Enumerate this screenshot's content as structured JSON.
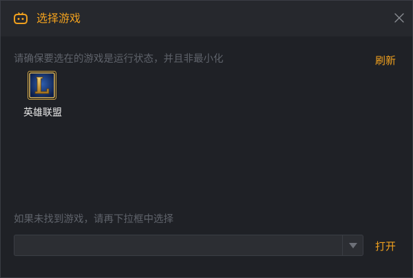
{
  "window": {
    "title": "选择游戏",
    "title_icon": "gamepad-icon",
    "close_icon": "close-icon"
  },
  "main": {
    "hint": "请确保要选在的游戏是运行状态，并且非最小化",
    "refresh_label": "刷新",
    "games": [
      {
        "label": "英雄联盟",
        "icon": "league-of-legends-logo-icon"
      }
    ],
    "secondary_hint": "如果未找到游戏，请再下拉框中选择",
    "select_value": "",
    "open_label": "打开"
  },
  "colors": {
    "accent": "#f0a01e",
    "background": "#1f2126",
    "titlebar": "#26282d",
    "hint_text": "#5f636b"
  }
}
